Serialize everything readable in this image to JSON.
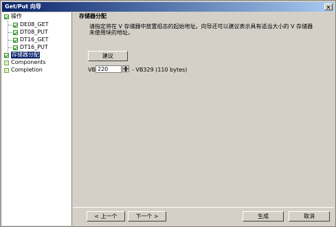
{
  "window": {
    "title": "Get/Put 向导",
    "close_glyph": "×"
  },
  "tree": {
    "items": [
      {
        "label": "操作",
        "state": "checked"
      },
      {
        "label": "DE08_GET",
        "state": "checked"
      },
      {
        "label": "DT08_PUT",
        "state": "checked"
      },
      {
        "label": "DT16_GET",
        "state": "checked"
      },
      {
        "label": "DT16_PUT",
        "state": "checked"
      },
      {
        "label": "存储器分配",
        "state": "checked",
        "selected": true
      },
      {
        "label": "Components",
        "state": "unchecked"
      },
      {
        "label": "Completion",
        "state": "unchecked"
      }
    ]
  },
  "main": {
    "heading": "存储器分配",
    "description": "请指定将在 V 存储器中放置组态的起始地址。向导还可以建议表示具有适当大小的 V 存储器未使用块的地址。",
    "suggest_button": "建议",
    "vb_label": "VB",
    "vb_value": "220",
    "vb_range": "- VB329 (110 bytes)"
  },
  "footer": {
    "prev": "< 上一个",
    "next": "下一个 >",
    "finish": "生成",
    "cancel": "取消"
  }
}
